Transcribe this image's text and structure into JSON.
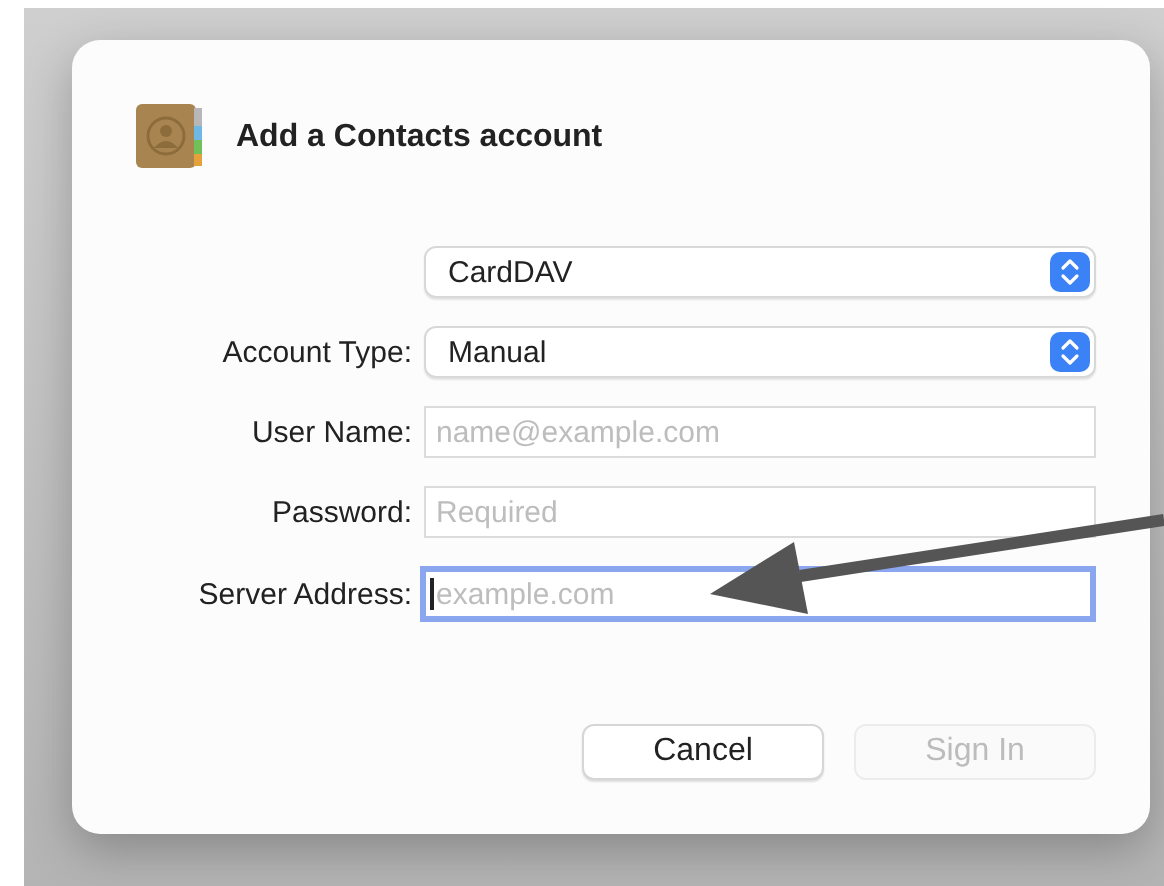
{
  "dialog": {
    "title": "Add a Contacts account"
  },
  "fields": [
    {
      "kind": "popup",
      "value": "CardDAV"
    },
    {
      "kind": "popup",
      "label": "Account Type:",
      "value": "Manual"
    },
    {
      "kind": "text",
      "label": "User Name:",
      "placeholder": "name@example.com",
      "focused": false
    },
    {
      "kind": "text",
      "label": "Password:",
      "placeholder": "Required",
      "focused": false
    },
    {
      "kind": "text",
      "label": "Server Address:",
      "placeholder": "example.com",
      "focused": true
    }
  ],
  "buttons": [
    {
      "label": "Cancel",
      "disabled": false
    },
    {
      "label": "Sign In",
      "disabled": true
    }
  ]
}
